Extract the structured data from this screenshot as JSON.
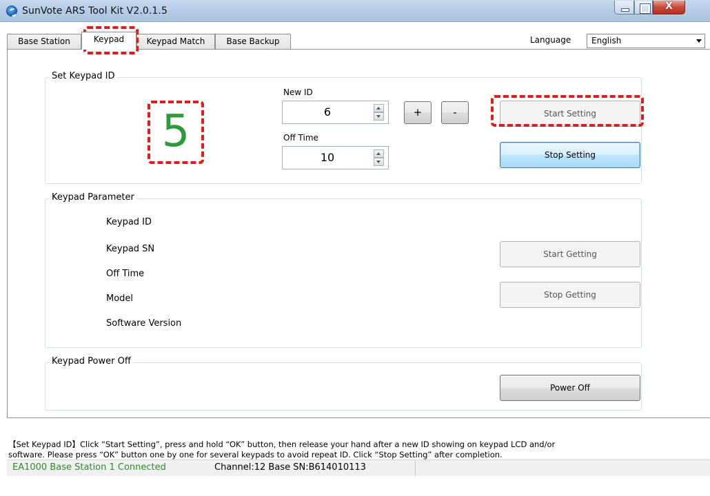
{
  "window": {
    "title": "SunVote ARS Tool Kit  V2.0.1.5"
  },
  "tabs": [
    {
      "label": "Base Station"
    },
    {
      "label": "Keypad"
    },
    {
      "label": "Keypad Match"
    },
    {
      "label": "Base Backup"
    }
  ],
  "active_tab": "Keypad",
  "language": {
    "label": "Language",
    "value": "English"
  },
  "set_keypad_id": {
    "title": "Set Keypad ID",
    "current_id": "5",
    "new_id_label": "New ID",
    "new_id_value": "6",
    "plus_label": "+",
    "minus_label": "-",
    "off_time_label": "Off Time",
    "off_time_value": "10",
    "start_setting_label": "Start Setting",
    "stop_setting_label": "Stop Setting"
  },
  "keypad_parameter": {
    "title": "Keypad Parameter",
    "fields": [
      "Keypad ID",
      "Keypad SN",
      "Off Time",
      "Model",
      "Software Version"
    ],
    "start_getting_label": "Start Getting",
    "stop_getting_label": "Stop Getting"
  },
  "keypad_power_off": {
    "title": "Keypad Power Off",
    "power_off_label": "Power Off"
  },
  "info": {
    "line1": "【Set Keypad ID】Click “Start Setting”, press and hold “OK” button, then release your hand after a new ID showing on keypad LCD and/or",
    "line2": "software. Please press “OK” button one by one for several keypads to avoid repeat ID. Click “Stop Setting” after completion."
  },
  "status": {
    "connection": "EA1000  Base Station 1 Connected",
    "details": "Channel:12  Base SN:B614010113"
  },
  "colors": {
    "status_green": "#2e8b2e",
    "digit_green": "#2e9a3d",
    "highlight_red": "#e01b1b"
  }
}
